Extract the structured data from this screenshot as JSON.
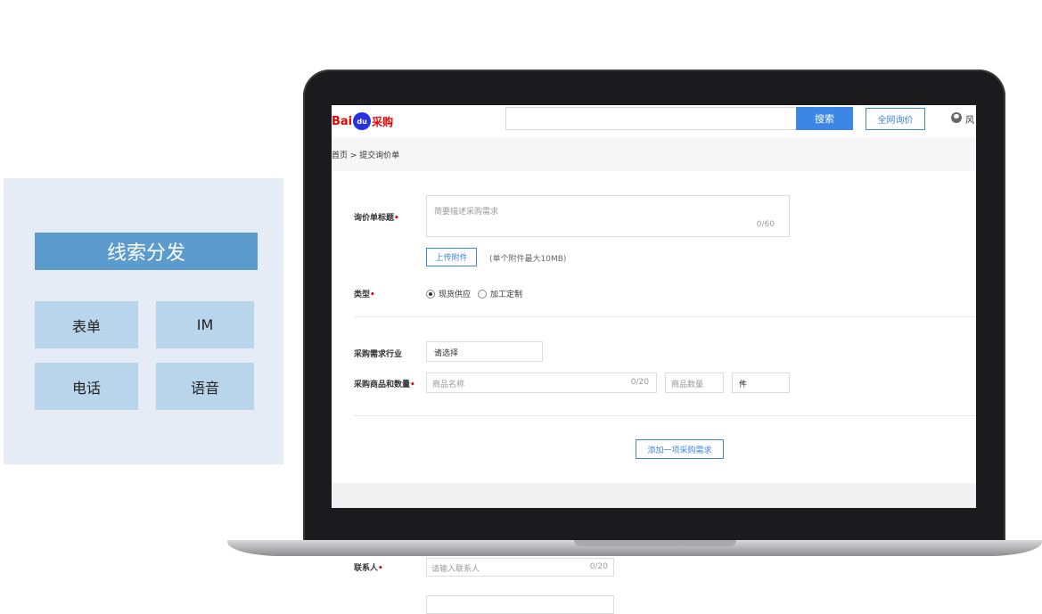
{
  "lead_panel": {
    "title": "线索分发",
    "tiles": [
      "表单",
      "IM",
      "电话",
      "语音"
    ]
  },
  "header": {
    "logo_bai": "Bai",
    "logo_du": "du",
    "logo_cg": "采购",
    "search_button": "搜索",
    "fullnet_button": "全网询价",
    "user_text": "风"
  },
  "breadcrumb": "首页 > 提交询价单",
  "form": {
    "title_label": "询价单标题",
    "title_placeholder": "简要描述采购需求",
    "title_count": "0/60",
    "upload_button": "上传附件",
    "upload_hint": "(单个附件最大10MB)",
    "type_label": "类型",
    "type_option_1": "现货供应",
    "type_option_2": "加工定制",
    "industry_label": "采购需求行业",
    "industry_select": "请选择",
    "goods_label": "采购商品和数量",
    "goods_name_placeholder": "商品名称",
    "goods_name_count": "0/20",
    "goods_qty_placeholder": "商品数量",
    "unit_select": "件",
    "add_button": "添加一项采购需求",
    "contact_label": "联系人",
    "contact_placeholder": "请输入联系人",
    "contact_count": "0/20"
  },
  "colors": {
    "accent": "#3c86e6",
    "required": "#e10602",
    "lead_header": "#5b9bcd",
    "lead_tile": "#b9d5ec"
  }
}
